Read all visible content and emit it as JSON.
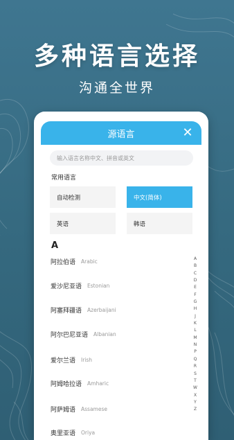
{
  "promo": {
    "headline": "多种语言选择",
    "tagline": "沟通全世界"
  },
  "colors": {
    "accent": "#39b3ea",
    "background": "#3f7690",
    "chip_bg": "#f4f4f4"
  },
  "modal": {
    "title": "源语言",
    "close_icon": "close-icon"
  },
  "search": {
    "placeholder": "输入语言名称中文、拼音或英文"
  },
  "common": {
    "label": "常用语言",
    "chips": [
      {
        "label": "自动检测",
        "selected": false
      },
      {
        "label": "中文(简体)",
        "selected": true
      },
      {
        "label": "英语",
        "selected": false
      },
      {
        "label": "韩语",
        "selected": false
      }
    ]
  },
  "list": {
    "section_letter": "A",
    "items": [
      {
        "cn": "阿拉伯语",
        "en": "Arabic"
      },
      {
        "cn": "爱沙尼亚语",
        "en": "Estonian"
      },
      {
        "cn": "阿塞拜疆语",
        "en": "Azerbaijani"
      },
      {
        "cn": "阿尔巴尼亚语",
        "en": "Albanian"
      },
      {
        "cn": "爱尔兰语",
        "en": "Irish"
      },
      {
        "cn": "阿姆哈拉语",
        "en": "Amharic"
      },
      {
        "cn": "阿萨姆语",
        "en": "Assamese"
      },
      {
        "cn": "奥里亚语",
        "en": "Oriya"
      }
    ]
  },
  "index": [
    "A",
    "B",
    "C",
    "D",
    "E",
    "F",
    "G",
    "H",
    "J",
    "K",
    "L",
    "M",
    "N",
    "P",
    "Q",
    "R",
    "S",
    "T",
    "W",
    "X",
    "Y",
    "Z"
  ]
}
